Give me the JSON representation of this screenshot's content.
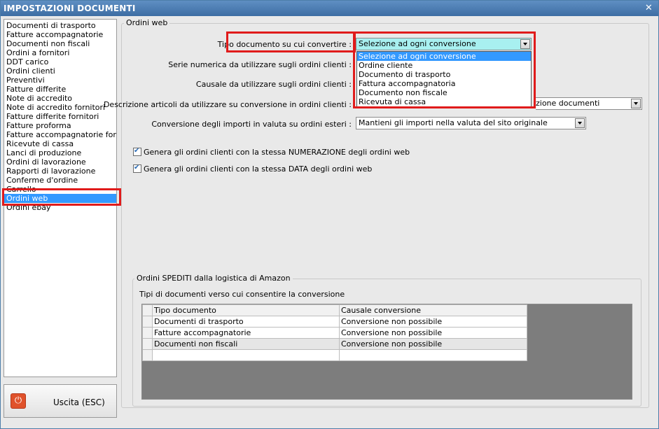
{
  "window": {
    "title": "IMPOSTAZIONI DOCUMENTI",
    "close_glyph": "✕"
  },
  "sidebar": {
    "items": [
      "Documenti di trasporto",
      "Fatture accompagnatorie",
      "Documenti non fiscali",
      "Ordini a fornitori",
      "DDT carico",
      "Ordini clienti",
      "Preventivi",
      "Fatture differite",
      "Note di accredito",
      "Note di accredito fornitori",
      "Fatture differite fornitori",
      "Fatture proforma",
      "Fatture accompagnatorie fornito",
      "Ricevute di cassa",
      "Lanci di produzione",
      "Ordini di lavorazione",
      "Rapporti di lavorazione",
      "Conferme d'ordine",
      "Carrello",
      "Ordini web",
      "Ordini ebay"
    ],
    "selected": "Ordini web"
  },
  "exit_button": {
    "label": "Uscita (ESC)",
    "icon": "power-icon"
  },
  "ordini_web": {
    "legend": "Ordini web",
    "tipo_label": "Tipo documento su cui convertire :",
    "tipo_value": "Selezione ad ogni conversione",
    "tipo_options": [
      "Selezione ad ogni conversione",
      "Ordine cliente",
      "Documento di trasporto",
      "Fattura accompagnatoria",
      "Documento non fiscale",
      "Ricevuta di cassa"
    ],
    "serie_label": "Serie numerica da utilizzare sugli ordini clienti :",
    "causale_label": "Causale da utilizzare sugli ordini clienti :",
    "descrizione_label": "Descrizione articoli da utilizzare su conversione in ordini clienti :",
    "descrizione_value": "zione documenti",
    "valuta_label": "Conversione degli importi in valuta su ordini esteri :",
    "valuta_value": "Mantieni gli importi nella valuta del sito originale",
    "check_numerazione": "Genera gli ordini clienti con la stessa NUMERAZIONE degli ordini web",
    "check_data": "Genera gli ordini clienti con la stessa DATA degli ordini web"
  },
  "amazon": {
    "legend": "Ordini SPEDITI dalla logistica di Amazon",
    "subtitle": "Tipi di documenti verso cui consentire la conversione",
    "columns": [
      "Tipo documento",
      "Causale conversione"
    ],
    "rows": [
      [
        "Documenti di trasporto",
        "Conversione non possibile"
      ],
      [
        "Fatture accompagnatorie",
        "Conversione non possibile"
      ],
      [
        "Documenti non fiscali",
        "Conversione non possibile"
      ],
      [
        "",
        ""
      ]
    ]
  },
  "colors": {
    "highlight": "#e01b1b",
    "selection": "#3399ff",
    "titlebar": "#4a7bb1"
  }
}
